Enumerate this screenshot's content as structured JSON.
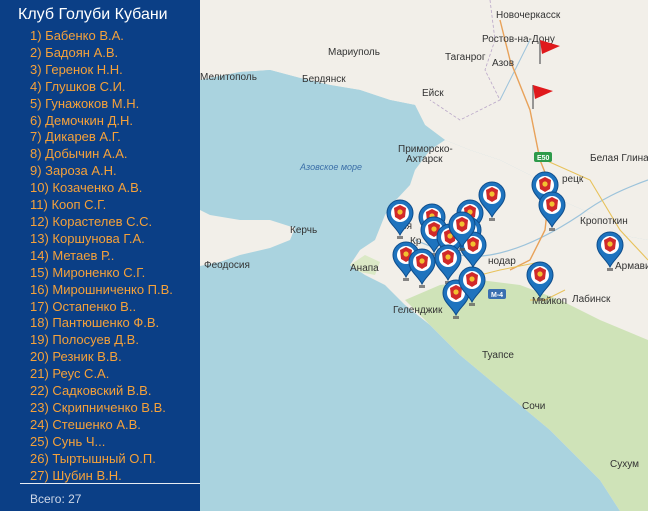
{
  "sidebar": {
    "title": "Клуб Голуби Кубани",
    "members": [
      {
        "num": "1)",
        "name": "Бабенко В.А."
      },
      {
        "num": "2)",
        "name": "Бадоян А.В."
      },
      {
        "num": "3)",
        "name": "Геренок Н.Н."
      },
      {
        "num": "4)",
        "name": "Глушков С.И."
      },
      {
        "num": "5)",
        "name": "Гунажоков М.Н."
      },
      {
        "num": "6)",
        "name": "Демочкин Д.Н."
      },
      {
        "num": "7)",
        "name": "Дикарев А.Г."
      },
      {
        "num": "8)",
        "name": "Добычин А.А."
      },
      {
        "num": "9)",
        "name": "Зароза А.Н."
      },
      {
        "num": "10)",
        "name": "Козаченко А.В."
      },
      {
        "num": "11)",
        "name": "Кооп С.Г."
      },
      {
        "num": "12)",
        "name": "Корастелев С.С."
      },
      {
        "num": "13)",
        "name": "Коршунова Г.А."
      },
      {
        "num": "14)",
        "name": "Метаев Р.."
      },
      {
        "num": "15)",
        "name": "Мироненко С.Г."
      },
      {
        "num": "16)",
        "name": "Мирошниченко П.В."
      },
      {
        "num": "17)",
        "name": "Остапенко В.."
      },
      {
        "num": "18)",
        "name": "Пантюшенко Ф.В."
      },
      {
        "num": "19)",
        "name": "Полосуев Д.В."
      },
      {
        "num": "20)",
        "name": "Резник В.В."
      },
      {
        "num": "21)",
        "name": "Реус С.А."
      },
      {
        "num": "22)",
        "name": "Садковский В.В."
      },
      {
        "num": "23)",
        "name": "Скрипниченко В.В."
      },
      {
        "num": "24)",
        "name": "Стешенко А.В."
      },
      {
        "num": "25)",
        "name": "Сунь Ч..."
      },
      {
        "num": "26)",
        "name": "Тыртышный О.П."
      },
      {
        "num": "27)",
        "name": "Шубин В.Н."
      }
    ],
    "total_label": "Всего: 27"
  },
  "map": {
    "sea_label": "Азовское море",
    "cities": {
      "novocherkassk": "Новочеркасск",
      "rostov": "Ростов-на-Дону",
      "mariupol": "Мариуполь",
      "taganrog": "Таганрог",
      "azov": "Азов",
      "melitopol": "Мелитополь",
      "berdyansk": "Бердянск",
      "eysk": "Ейск",
      "primorsko_1": "Приморско-",
      "primorsko_2": "Ахтарск",
      "belaya_glina": "Белая Глина",
      "kerch": "Керчь",
      "feodosiya": "Феодосия",
      "anapa": "Анапа",
      "krasnodar": "нодар",
      "gelendzhik": "Геленджик",
      "maykop": "Майкоп",
      "kropotkin": "Кропоткин",
      "armavir": "Армавир",
      "labinsk": "Лабинск",
      "tuapse": "Туапсе",
      "sochi": "Сочи",
      "sukhum": "Сухум",
      "tikhoretsk": "рецк",
      "slavyansk": "явя",
      "krymsk": "Кр"
    },
    "roads": {
      "e50": "E50",
      "m4": "M-4"
    },
    "colors": {
      "land": "#f2efe9",
      "sea": "#aad3df",
      "green": "#cfe3b8",
      "marker": "#1e73be",
      "flag": "#e0191c"
    }
  }
}
